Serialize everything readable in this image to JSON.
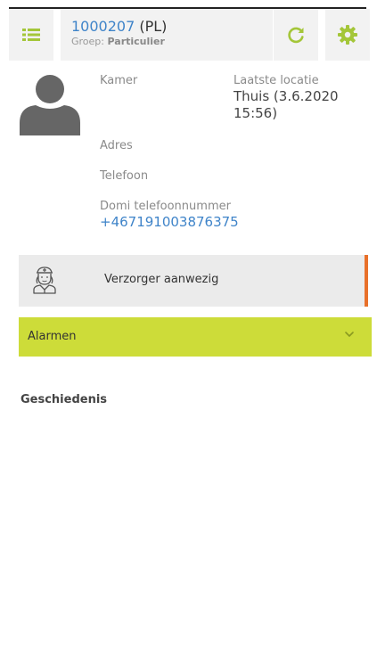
{
  "header": {
    "menu_icon": "list-icon",
    "client_id": "1000207",
    "client_suffix": " (PL)",
    "group_label": "Groep: ",
    "group_value": "Particulier",
    "refresh_icon": "refresh-icon",
    "settings_icon": "gear-icon"
  },
  "profile": {
    "avatar_icon": "user-avatar-icon",
    "room_label": "Kamer",
    "room_value": "",
    "last_location_label": "Laatste locatie",
    "last_location_value_line1": "Thuis (3.6.2020",
    "last_location_value_line2": "15:56)",
    "address_label": "Adres",
    "phone_label": "Telefoon",
    "domi_phone_label": "Domi telefoonnummer",
    "domi_phone_value": "+467191003876375"
  },
  "caregiver": {
    "icon": "caregiver-icon",
    "label": "Verzorger aanwezig",
    "status_color": "#e8702a"
  },
  "alarms": {
    "label": "Alarmen",
    "chevron_icon": "chevron-down-icon",
    "bar_color": "#cddc39"
  },
  "history": {
    "title": "Geschiedenis"
  },
  "colors": {
    "accent": "#a4c639",
    "link": "#3f84c9"
  }
}
